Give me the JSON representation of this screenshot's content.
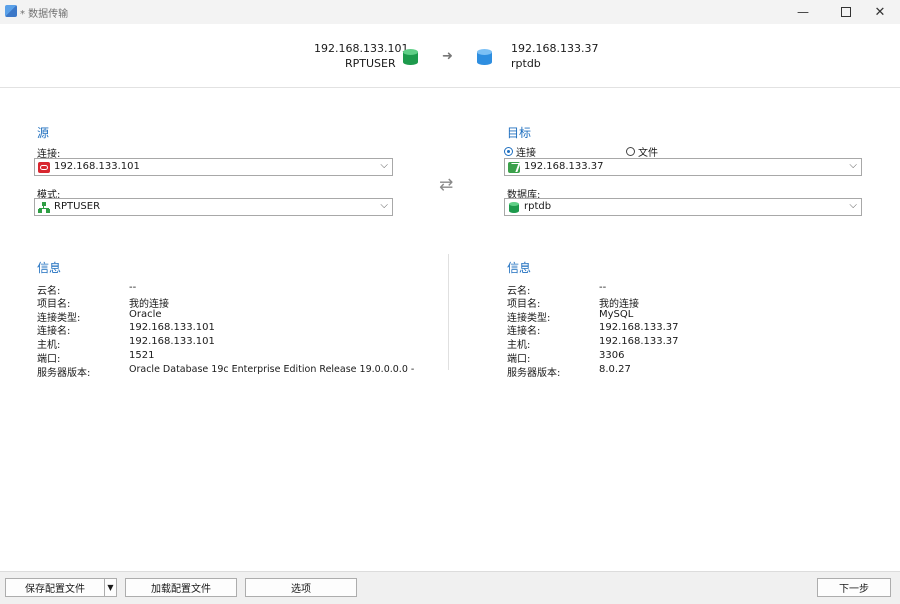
{
  "window": {
    "title": "* 数据传输",
    "controls": [
      "minimize",
      "maximize",
      "close"
    ]
  },
  "header": {
    "source_host": "192.168.133.101",
    "source_name": "RPTUSER",
    "target_host": "192.168.133.37",
    "target_name": "rptdb",
    "icons": {
      "source": "green-database-icon",
      "arrow": "right-arrow-icon",
      "target": "blue-database-icon"
    }
  },
  "source": {
    "title": "源",
    "connection_label": "连接:",
    "connection_value": "192.168.133.101",
    "connection_icon": "oracle-icon",
    "schema_label": "模式:",
    "schema_value": "RPTUSER",
    "schema_icon": "schema-icon"
  },
  "target": {
    "title": "目标",
    "radio_connection": "连接",
    "radio_file": "文件",
    "selected": "connection",
    "connection_value": "192.168.133.37",
    "connection_icon": "mysql-icon",
    "database_label": "数据库:",
    "database_value": "rptdb",
    "database_icon": "database-icon"
  },
  "source_info": {
    "title": "信息",
    "rows": [
      {
        "key": "云名:",
        "value": "--"
      },
      {
        "key": "项目名:",
        "value": "我的连接"
      },
      {
        "key": "连接类型:",
        "value": "Oracle"
      },
      {
        "key": "连接名:",
        "value": "192.168.133.101"
      },
      {
        "key": "主机:",
        "value": "192.168.133.101"
      },
      {
        "key": "端口:",
        "value": "1521"
      },
      {
        "key": "服务器版本:",
        "value": "Oracle Database 19c Enterprise Edition Release 19.0.0.0.0 -"
      }
    ]
  },
  "target_info": {
    "title": "信息",
    "rows": [
      {
        "key": "云名:",
        "value": "--"
      },
      {
        "key": "项目名:",
        "value": "我的连接"
      },
      {
        "key": "连接类型:",
        "value": "MySQL"
      },
      {
        "key": "连接名:",
        "value": "192.168.133.37"
      },
      {
        "key": "主机:",
        "value": "192.168.133.37"
      },
      {
        "key": "端口:",
        "value": "3306"
      },
      {
        "key": "服务器版本:",
        "value": "8.0.27"
      }
    ]
  },
  "footer": {
    "save_config": "保存配置文件",
    "load_config": "加载配置文件",
    "options": "选项",
    "next": "下一步"
  },
  "colors": {
    "accent": "#1f6fbf",
    "oracle": "#d8262f",
    "mysql": "#3aa04a",
    "db_green": "#1d9a4c",
    "db_blue": "#2e8ee0"
  }
}
